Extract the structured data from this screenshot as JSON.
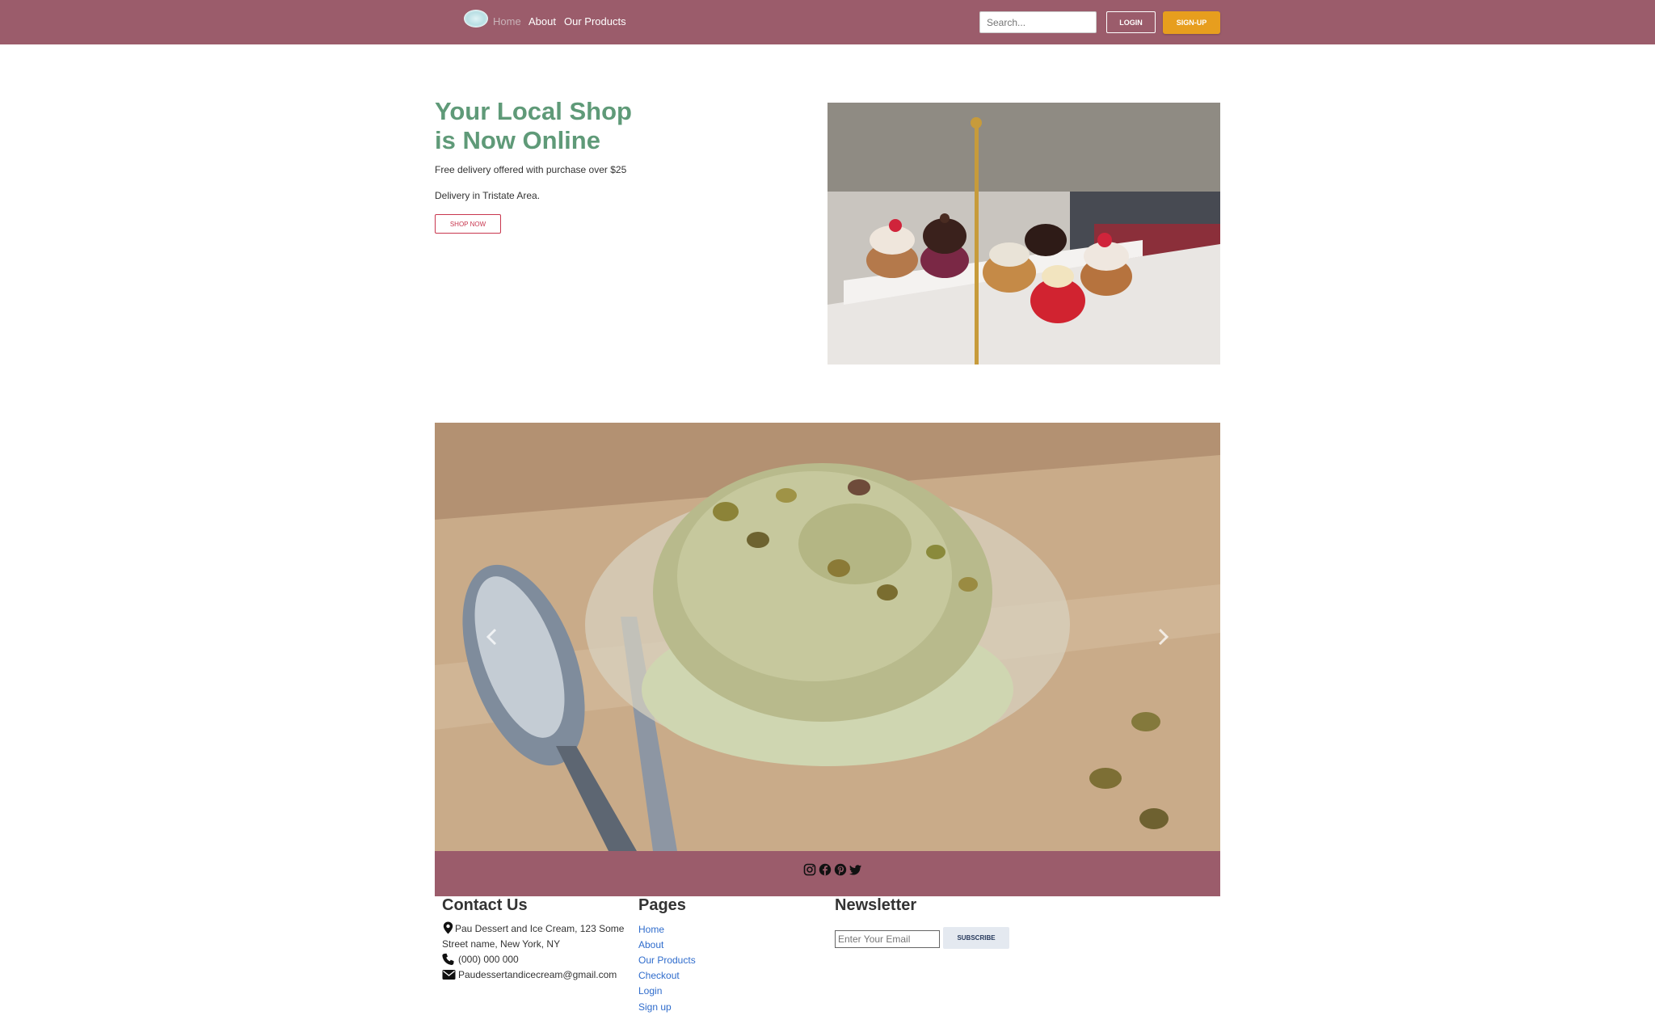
{
  "nav": {
    "links": [
      "Home",
      "About",
      "Our Products"
    ],
    "search_placeholder": "Search...",
    "login_label": "LOGIN",
    "signup_label": "SIGN-UP"
  },
  "hero": {
    "title_line1": "Your Local Shop",
    "title_line2": "is Now Online",
    "text1": "Free delivery offered with purchase over $25",
    "text2": "Delivery in Tristate Area.",
    "cta_label": "SHOP NOW"
  },
  "carousel": {
    "prev_icon": "chevron-left-icon",
    "next_icon": "chevron-right-icon"
  },
  "social": {
    "icons": [
      "instagram-icon",
      "facebook-icon",
      "pinterest-icon",
      "twitter-icon"
    ]
  },
  "footer": {
    "contact": {
      "heading": "Contact Us",
      "address_line1": "Pau Dessert and Ice Cream, 123 Some",
      "address_line2": "Street name, New York, NY",
      "phone": "(000) 000 000",
      "email": "Paudessertandicecream@gmail.com"
    },
    "pages": {
      "heading": "Pages",
      "links": [
        "Home",
        "About",
        "Our Products",
        "Checkout",
        "Login",
        "Sign up"
      ]
    },
    "newsletter": {
      "heading": "Newsletter",
      "email_placeholder": "Enter Your Email",
      "subscribe_label": "SUBSCRIBE"
    }
  },
  "colors": {
    "navbar": "#9b5c6b",
    "accent_green": "#5f9a78",
    "signup": "#e79e1e",
    "link_blue": "#2f6ccc",
    "cta_red": "#c8364e"
  }
}
